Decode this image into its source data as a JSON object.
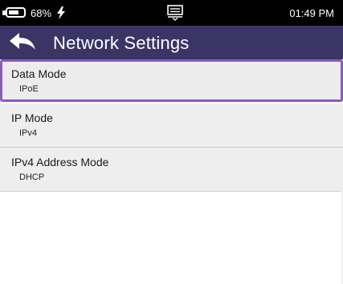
{
  "status_bar": {
    "battery_percent": "68%",
    "battery_level": 0.68,
    "charging_icon": "lightning-bolt-icon",
    "notification_icon": "keyboard-icon",
    "time": "01:49 PM"
  },
  "header": {
    "back_icon": "back-arrow-icon",
    "title": "Network Settings",
    "background_color": "#3b3565"
  },
  "settings": {
    "items": [
      {
        "label": "Data Mode",
        "value": "IPoE",
        "selected": true
      },
      {
        "label": "IP Mode",
        "value": "IPv4",
        "selected": false
      },
      {
        "label": "IPv4 Address Mode",
        "value": "DHCP",
        "selected": false
      }
    ],
    "selection_color": "#8a5bbf"
  }
}
